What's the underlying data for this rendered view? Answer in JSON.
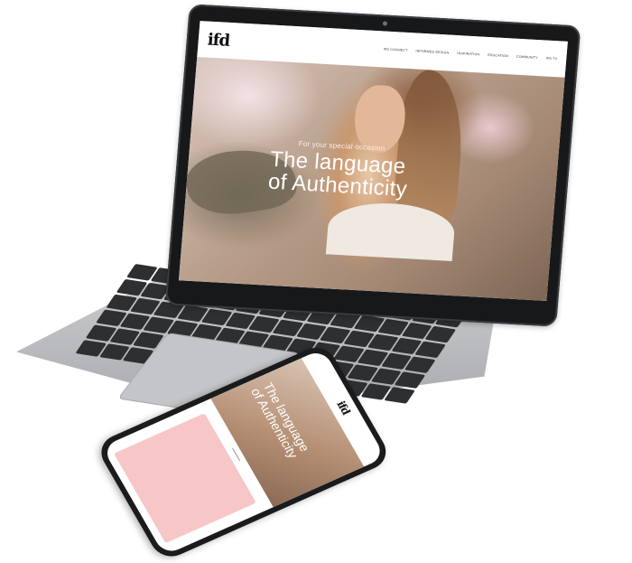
{
  "site": {
    "logo": "ifd",
    "nav": [
      "ifd connect",
      "informed design",
      "inspiration",
      "education",
      "community",
      "ifd tv"
    ]
  },
  "hero": {
    "eyebrow": "For your special occasion",
    "title_line1": "The language",
    "title_line2": "of Authenticity"
  },
  "phone": {
    "logo": "ifd",
    "hero_title_line1": "The language",
    "hero_title_line2": "of Authenticity"
  },
  "colors": {
    "laptop_bezel": "#17181a",
    "laptop_body": "#c1c2c5",
    "key": "#2e2f31",
    "phone_card": "#f7c7c7"
  }
}
